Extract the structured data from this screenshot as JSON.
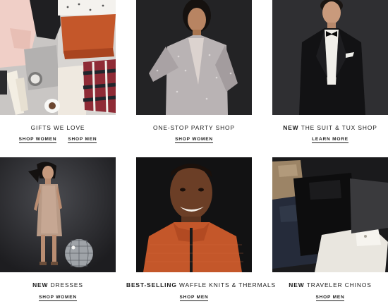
{
  "tiles": [
    {
      "bold": "",
      "title": "Gifts We Love",
      "links": [
        "Shop Women",
        "Shop Men"
      ],
      "photo": "flat-lay-gifts"
    },
    {
      "bold": "",
      "title": "One-Stop Party Shop",
      "links": [
        "Shop Women"
      ],
      "photo": "woman-sequin-jacket"
    },
    {
      "bold": "New",
      "title": "The Suit & Tux Shop",
      "links": [
        "Learn More"
      ],
      "photo": "man-tuxedo"
    },
    {
      "bold": "New",
      "title": "Dresses",
      "links": [
        "Shop Women"
      ],
      "photo": "woman-slip-dress-disco-ball"
    },
    {
      "bold": "Best-Selling",
      "title": "Waffle Knits & Thermals",
      "links": [
        "Shop Men"
      ],
      "photo": "man-orange-zip-knit"
    },
    {
      "bold": "New",
      "title": "Traveler Chinos",
      "links": [
        "Shop Men"
      ],
      "photo": "folded-chinos"
    }
  ],
  "colors": {
    "text": "#1a1a1a",
    "background": "#ffffff",
    "rust": "#c4572a",
    "dark_photo": "#2a2a2d"
  }
}
